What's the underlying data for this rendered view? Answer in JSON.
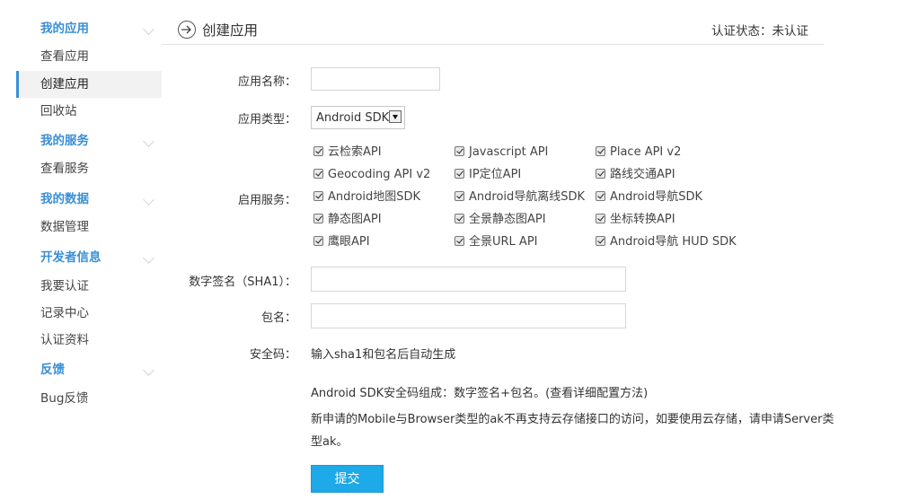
{
  "sidebar": {
    "sections": [
      {
        "title": "我的应用",
        "items": [
          "查看应用",
          "创建应用",
          "回收站"
        ]
      },
      {
        "title": "我的服务",
        "items": [
          "查看服务"
        ]
      },
      {
        "title": "我的数据",
        "items": [
          "数据管理"
        ]
      },
      {
        "title": "开发者信息",
        "items": [
          "我要认证",
          "记录中心",
          "认证资料"
        ]
      },
      {
        "title": "反馈",
        "items": [
          "Bug反馈"
        ]
      }
    ],
    "active_item": "创建应用"
  },
  "header": {
    "icon": "arrow-circle-icon",
    "title": "创建应用",
    "status": "认证状态：未认证"
  },
  "form": {
    "app_name_label": "应用名称：",
    "app_name_value": "",
    "app_type_label": "应用类型：",
    "app_type_value": "Android SDK",
    "services_label": "启用服务：",
    "services": [
      [
        "云检索API",
        "Javascript API",
        "Place API v2"
      ],
      [
        "Geocoding API v2",
        "IP定位API",
        "路线交通API"
      ],
      [
        "Android地图SDK",
        "Android导航离线SDK",
        "Android导航SDK"
      ],
      [
        "静态图API",
        "全景静态图API",
        "坐标转换API"
      ],
      [
        "鹰眼API",
        "全景URL API",
        "Android导航 HUD SDK"
      ]
    ],
    "sha1_label": "数字签名（SHA1）：",
    "sha1_value": "",
    "package_label": "包名：",
    "package_value": "",
    "security_label": "安全码：",
    "security_value": "输入sha1和包名后自动生成",
    "note1": "Android SDK安全码组成：数字签名+包名。(查看详细配置方法)",
    "note2_line1": "新申请的Mobile与Browser类型的ak不再支持云存储接口的访问，如要使用云存储，请申请Server类",
    "note2_line2": "型ak。",
    "submit_label": "提交"
  }
}
